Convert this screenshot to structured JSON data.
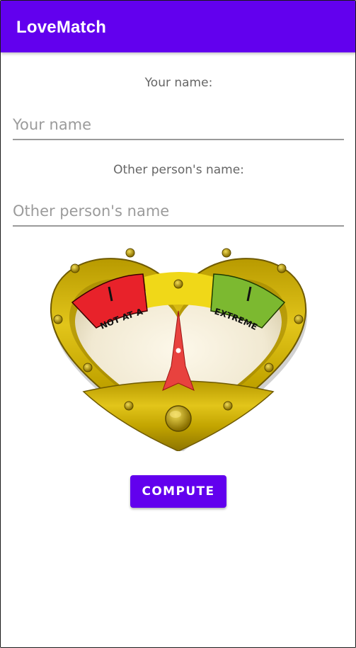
{
  "app": {
    "title": "LoveMatch"
  },
  "form": {
    "your_name_label": "Your name:",
    "your_name_placeholder": "Your name",
    "your_name_value": "",
    "other_name_label": "Other person's name:",
    "other_name_placeholder": "Other person's name",
    "other_name_value": ""
  },
  "meter": {
    "icon": "love-meter-heart-gauge",
    "low_label": "NOT AT ALL",
    "high_label": "EXTREMELY",
    "needle_level": 0.5
  },
  "actions": {
    "compute_label": "COMPUTE"
  },
  "colors": {
    "primary": "#6200EE",
    "gauge_red": "#E8222A",
    "gauge_green": "#7CB930",
    "frame_gold": "#C9A800",
    "needle": "#E8423E"
  }
}
